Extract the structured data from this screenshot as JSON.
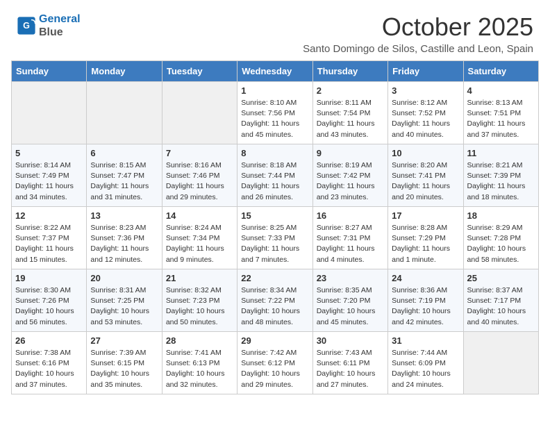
{
  "header": {
    "logo_line1": "General",
    "logo_line2": "Blue",
    "title": "October 2025",
    "subtitle": "Santo Domingo de Silos, Castille and Leon, Spain"
  },
  "weekdays": [
    "Sunday",
    "Monday",
    "Tuesday",
    "Wednesday",
    "Thursday",
    "Friday",
    "Saturday"
  ],
  "weeks": [
    [
      {
        "num": "",
        "info": ""
      },
      {
        "num": "",
        "info": ""
      },
      {
        "num": "",
        "info": ""
      },
      {
        "num": "1",
        "info": "Sunrise: 8:10 AM\nSunset: 7:56 PM\nDaylight: 11 hours\nand 45 minutes."
      },
      {
        "num": "2",
        "info": "Sunrise: 8:11 AM\nSunset: 7:54 PM\nDaylight: 11 hours\nand 43 minutes."
      },
      {
        "num": "3",
        "info": "Sunrise: 8:12 AM\nSunset: 7:52 PM\nDaylight: 11 hours\nand 40 minutes."
      },
      {
        "num": "4",
        "info": "Sunrise: 8:13 AM\nSunset: 7:51 PM\nDaylight: 11 hours\nand 37 minutes."
      }
    ],
    [
      {
        "num": "5",
        "info": "Sunrise: 8:14 AM\nSunset: 7:49 PM\nDaylight: 11 hours\nand 34 minutes."
      },
      {
        "num": "6",
        "info": "Sunrise: 8:15 AM\nSunset: 7:47 PM\nDaylight: 11 hours\nand 31 minutes."
      },
      {
        "num": "7",
        "info": "Sunrise: 8:16 AM\nSunset: 7:46 PM\nDaylight: 11 hours\nand 29 minutes."
      },
      {
        "num": "8",
        "info": "Sunrise: 8:18 AM\nSunset: 7:44 PM\nDaylight: 11 hours\nand 26 minutes."
      },
      {
        "num": "9",
        "info": "Sunrise: 8:19 AM\nSunset: 7:42 PM\nDaylight: 11 hours\nand 23 minutes."
      },
      {
        "num": "10",
        "info": "Sunrise: 8:20 AM\nSunset: 7:41 PM\nDaylight: 11 hours\nand 20 minutes."
      },
      {
        "num": "11",
        "info": "Sunrise: 8:21 AM\nSunset: 7:39 PM\nDaylight: 11 hours\nand 18 minutes."
      }
    ],
    [
      {
        "num": "12",
        "info": "Sunrise: 8:22 AM\nSunset: 7:37 PM\nDaylight: 11 hours\nand 15 minutes."
      },
      {
        "num": "13",
        "info": "Sunrise: 8:23 AM\nSunset: 7:36 PM\nDaylight: 11 hours\nand 12 minutes."
      },
      {
        "num": "14",
        "info": "Sunrise: 8:24 AM\nSunset: 7:34 PM\nDaylight: 11 hours\nand 9 minutes."
      },
      {
        "num": "15",
        "info": "Sunrise: 8:25 AM\nSunset: 7:33 PM\nDaylight: 11 hours\nand 7 minutes."
      },
      {
        "num": "16",
        "info": "Sunrise: 8:27 AM\nSunset: 7:31 PM\nDaylight: 11 hours\nand 4 minutes."
      },
      {
        "num": "17",
        "info": "Sunrise: 8:28 AM\nSunset: 7:29 PM\nDaylight: 11 hours\nand 1 minute."
      },
      {
        "num": "18",
        "info": "Sunrise: 8:29 AM\nSunset: 7:28 PM\nDaylight: 10 hours\nand 58 minutes."
      }
    ],
    [
      {
        "num": "19",
        "info": "Sunrise: 8:30 AM\nSunset: 7:26 PM\nDaylight: 10 hours\nand 56 minutes."
      },
      {
        "num": "20",
        "info": "Sunrise: 8:31 AM\nSunset: 7:25 PM\nDaylight: 10 hours\nand 53 minutes."
      },
      {
        "num": "21",
        "info": "Sunrise: 8:32 AM\nSunset: 7:23 PM\nDaylight: 10 hours\nand 50 minutes."
      },
      {
        "num": "22",
        "info": "Sunrise: 8:34 AM\nSunset: 7:22 PM\nDaylight: 10 hours\nand 48 minutes."
      },
      {
        "num": "23",
        "info": "Sunrise: 8:35 AM\nSunset: 7:20 PM\nDaylight: 10 hours\nand 45 minutes."
      },
      {
        "num": "24",
        "info": "Sunrise: 8:36 AM\nSunset: 7:19 PM\nDaylight: 10 hours\nand 42 minutes."
      },
      {
        "num": "25",
        "info": "Sunrise: 8:37 AM\nSunset: 7:17 PM\nDaylight: 10 hours\nand 40 minutes."
      }
    ],
    [
      {
        "num": "26",
        "info": "Sunrise: 7:38 AM\nSunset: 6:16 PM\nDaylight: 10 hours\nand 37 minutes."
      },
      {
        "num": "27",
        "info": "Sunrise: 7:39 AM\nSunset: 6:15 PM\nDaylight: 10 hours\nand 35 minutes."
      },
      {
        "num": "28",
        "info": "Sunrise: 7:41 AM\nSunset: 6:13 PM\nDaylight: 10 hours\nand 32 minutes."
      },
      {
        "num": "29",
        "info": "Sunrise: 7:42 AM\nSunset: 6:12 PM\nDaylight: 10 hours\nand 29 minutes."
      },
      {
        "num": "30",
        "info": "Sunrise: 7:43 AM\nSunset: 6:11 PM\nDaylight: 10 hours\nand 27 minutes."
      },
      {
        "num": "31",
        "info": "Sunrise: 7:44 AM\nSunset: 6:09 PM\nDaylight: 10 hours\nand 24 minutes."
      },
      {
        "num": "",
        "info": ""
      }
    ]
  ]
}
